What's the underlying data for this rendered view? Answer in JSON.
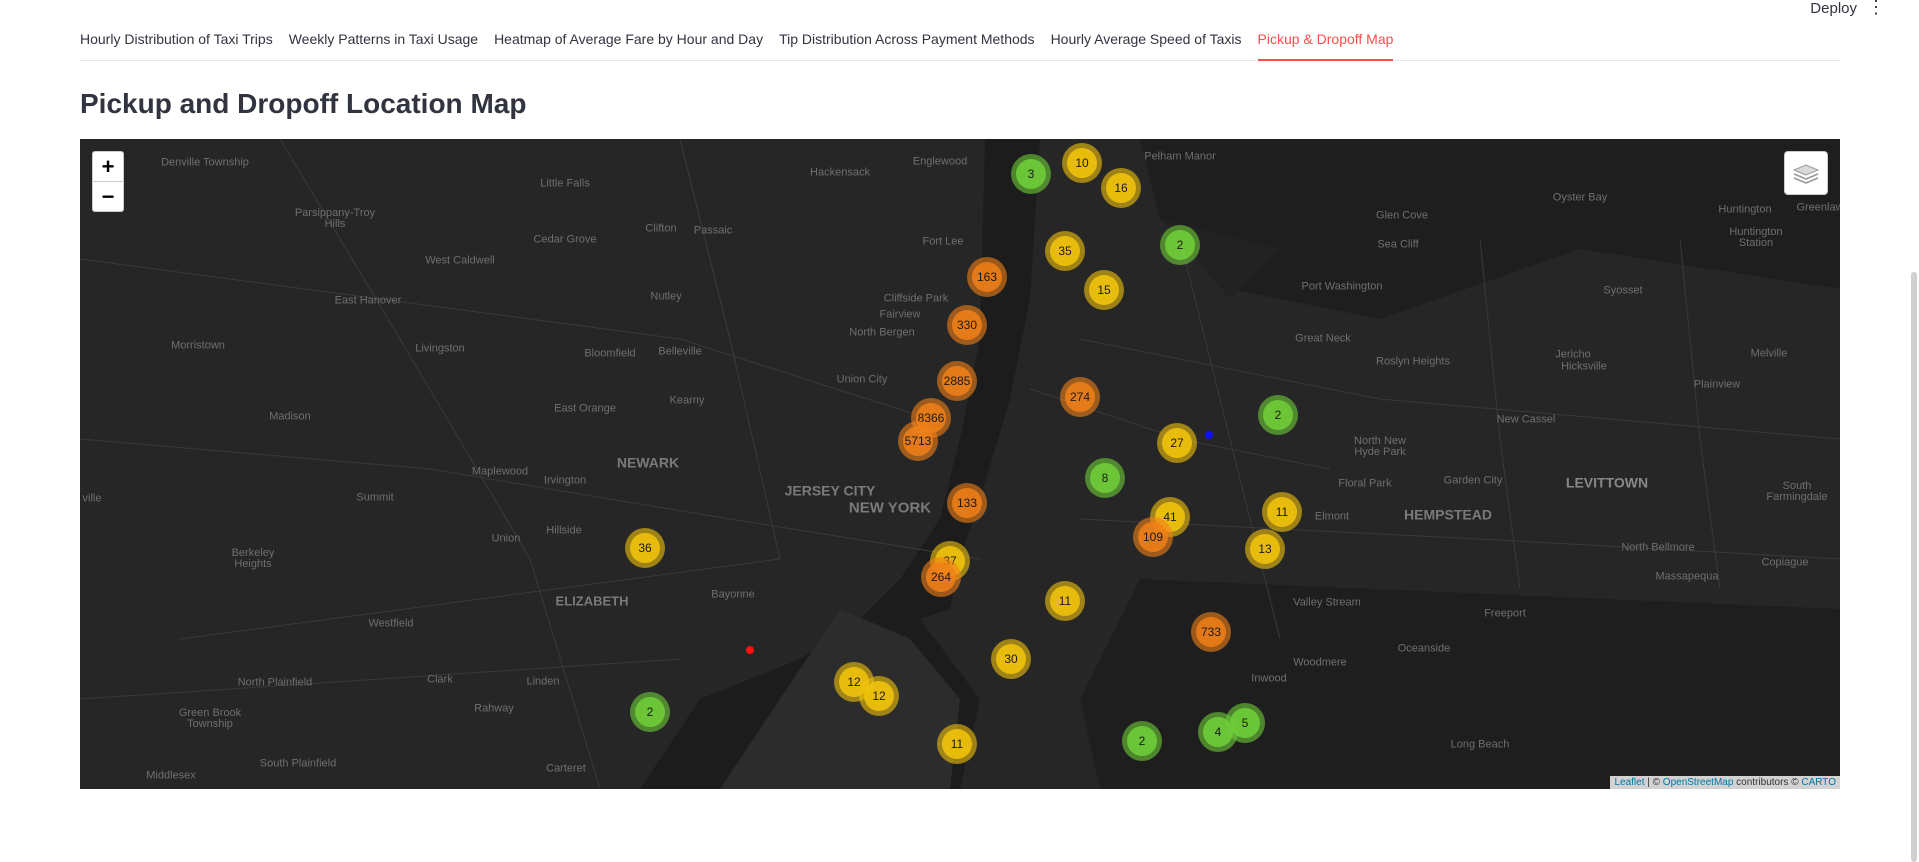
{
  "header": {
    "deploy_label": "Deploy",
    "menu_icon": "kebab-menu-icon"
  },
  "tabs": [
    {
      "label": "Hourly Distribution of Taxi Trips",
      "active": false
    },
    {
      "label": "Weekly Patterns in Taxi Usage",
      "active": false
    },
    {
      "label": "Heatmap of Average Fare by Hour and Day",
      "active": false
    },
    {
      "label": "Tip Distribution Across Payment Methods",
      "active": false
    },
    {
      "label": "Hourly Average Speed of Taxis",
      "active": false
    },
    {
      "label": "Pickup & Dropoff Map",
      "active": true
    }
  ],
  "page": {
    "title": "Pickup and Dropoff Location Map"
  },
  "map": {
    "zoom_in": "+",
    "zoom_out": "−",
    "layers_icon": "layers-icon",
    "attribution": {
      "leaflet": "Leaflet",
      "sep1": " | © ",
      "osm": "OpenStreetMap",
      "mid": " contributors © ",
      "carto": "CARTO"
    },
    "clusters": [
      "3",
      "10",
      "16",
      "35",
      "2",
      "15",
      "163",
      "330",
      "2885",
      "274",
      "8366",
      "5713",
      "27",
      "2",
      "8",
      "133",
      "41",
      "11",
      "109",
      "13",
      "36",
      "37",
      "264",
      "11",
      "733",
      "30",
      "12",
      "12",
      "2",
      "11",
      "2",
      "4",
      "5"
    ],
    "places": [
      "Denville Township",
      "Little Falls",
      "Hackensack",
      "Englewood",
      "Pelham Manor",
      "Oyster Bay",
      "Huntington",
      "Greenlaw",
      "Parsippany-Troy Hills",
      "Cedar Grove",
      "Clifton",
      "Passaic",
      "Glen Cove",
      "Huntington Station",
      "West Caldwell",
      "Fort Lee",
      "Sea Cliff",
      "East Hanover",
      "Nutley",
      "Cliffside Park",
      "Fairview",
      "Port Washington",
      "Syosset",
      "North Bergen",
      "Morristown",
      "Livingston",
      "Bloomfield",
      "Belleville",
      "Great Neck",
      "Roslyn Heights",
      "Jericho",
      "Melville",
      "Union City",
      "Plainview",
      "Madison",
      "East Orange",
      "Kearny",
      "Hicksville",
      "New Cassel",
      "North New Hyde Park",
      "NEWARK",
      "Maplewood",
      "Irvington",
      "Floral Park",
      "Garden City",
      "LEVITTOWN",
      "South Farmingdale",
      "Summit",
      "JERSEY CITY",
      "NEW YORK",
      "Elmont",
      "HEMPSTEAD",
      "Union",
      "Hillside",
      "North Bellmore",
      "Berkeley Heights",
      "Copiague",
      "Massapequa",
      "ELIZABETH",
      "Bayonne",
      "Valley Stream",
      "Freeport",
      "Westfield",
      "Oceanside",
      "Woodmere",
      "North Plainfield",
      "Clark",
      "Linden",
      "Inwood",
      "Rahway",
      "Green Brook Township",
      "Long Beach",
      "South Plainfield",
      "Carteret",
      "Middlesex",
      "ville"
    ]
  }
}
